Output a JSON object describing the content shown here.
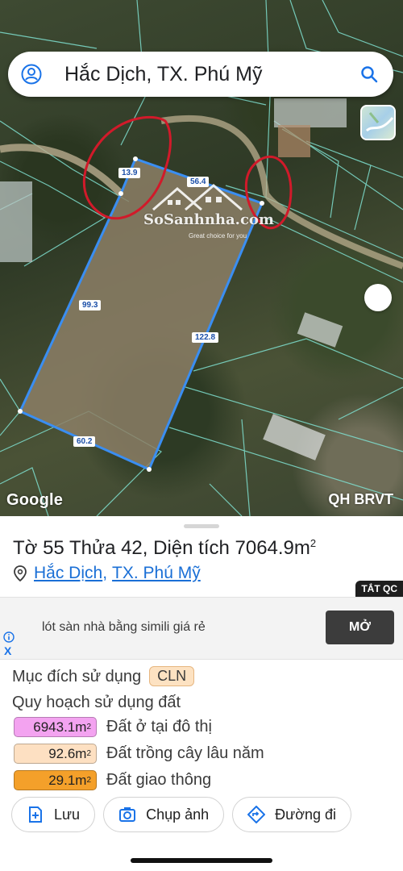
{
  "search": {
    "query": "Hắc Dịch, TX. Phú Mỹ"
  },
  "map": {
    "edge_labels": [
      "13.9",
      "56.4",
      "99.3",
      "122.8",
      "60.2"
    ],
    "watermark": {
      "brand": "SoSanhnha.com",
      "tagline": "Great choice for you"
    },
    "attribution": "Google",
    "layer_source": "QH BRVT",
    "colors": {
      "parcel_outline": "#3a8ef2",
      "annotation": "#d11a2a"
    }
  },
  "parcel": {
    "title": "Tờ 55 Thửa 42, Diện tích 7064.9m",
    "title_unit_sup": "2",
    "address": {
      "commune": "Hắc Dịch",
      "separator": ",",
      "town": "TX. Phú Mỹ"
    }
  },
  "ad": {
    "hide_label": "TẮT QC",
    "text": "lót sàn nhà bằng simili giá rẻ",
    "button": "MỞ",
    "close": "X"
  },
  "usage": {
    "purpose_label": "Mục đích sử dụng",
    "purpose_code": "CLN",
    "planning_label": "Quy hoạch sử dụng đất",
    "items": [
      {
        "area": "6943.1m",
        "desc": "Đất ở tại đô thị",
        "color": "#f3a3f0"
      },
      {
        "area": "92.6m",
        "desc": "Đất trồng cây lâu năm",
        "color": "#fde0c2"
      },
      {
        "area": "29.1m",
        "desc": "Đất giao thông",
        "color": "#f4a02a"
      }
    ]
  },
  "actions": {
    "save": "Lưu",
    "photo": "Chụp ảnh",
    "directions": "Đường đi"
  }
}
